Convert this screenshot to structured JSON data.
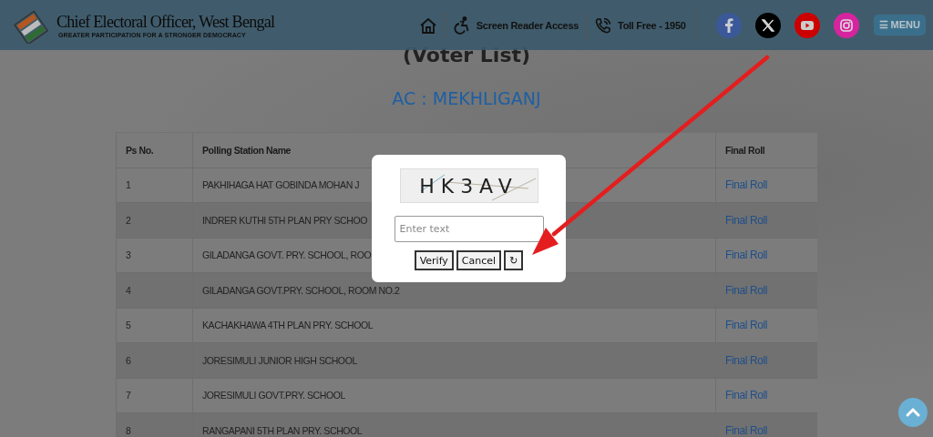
{
  "header": {
    "title": "Chief Electoral Officer, West Bengal",
    "tagline": "GREATER PARTICIPATION FOR A STRONGER DEMOCRACY",
    "links": [
      {
        "kind": "home"
      },
      {
        "kind": "access",
        "label": "Screen Reader Access"
      },
      {
        "kind": "phone",
        "label": "Toll Free - 1950"
      }
    ],
    "social": [
      {
        "kind": "facebook",
        "color": "#3b5998"
      },
      {
        "kind": "x",
        "color": "#000000"
      },
      {
        "kind": "youtube",
        "color": "#cc0000"
      },
      {
        "kind": "instagram",
        "color": "#d6249f"
      }
    ],
    "menu": {
      "icon": "☰",
      "label": "MENU"
    }
  },
  "page": {
    "subtitle": "(Voter List)",
    "ac": "AC : MEKHLIGANJ"
  },
  "table": {
    "columns": [
      "Ps No.",
      "Polling Station Name",
      "Final Roll"
    ],
    "rows": [
      {
        "ps": "1",
        "name": "PAKHIHAGA HAT GOBINDA MOHAN J",
        "link": "Final Roll"
      },
      {
        "ps": "2",
        "name": "INDRER KUTHI 5TH PLAN PRY SCHOO",
        "link": "Final Roll"
      },
      {
        "ps": "3",
        "name": "GILADANGA GOVT. PRY. SCHOOL, ROO",
        "link": "Final Roll"
      },
      {
        "ps": "4",
        "name": "GILADANGA GOVT.PRY. SCHOOL, ROOM NO.2",
        "link": "Final Roll"
      },
      {
        "ps": "5",
        "name": "KACHAKHAWA 4TH PLAN PRY. SCHOOL",
        "link": "Final Roll"
      },
      {
        "ps": "6",
        "name": "JORESIMULI JUNIOR HIGH SCHOOL",
        "link": "Final Roll"
      },
      {
        "ps": "7",
        "name": "JORESIMULI GOVT.PRY. SCHOOL",
        "link": "Final Roll"
      },
      {
        "ps": "8",
        "name": "RANGAPANI 5TH PLAN PRY. SCHOOL",
        "link": "Final Roll"
      }
    ]
  },
  "captcha": {
    "code": "HK3AV",
    "placeholder": "Enter text",
    "buttons": [
      "Verify",
      "Cancel",
      "↻"
    ]
  }
}
